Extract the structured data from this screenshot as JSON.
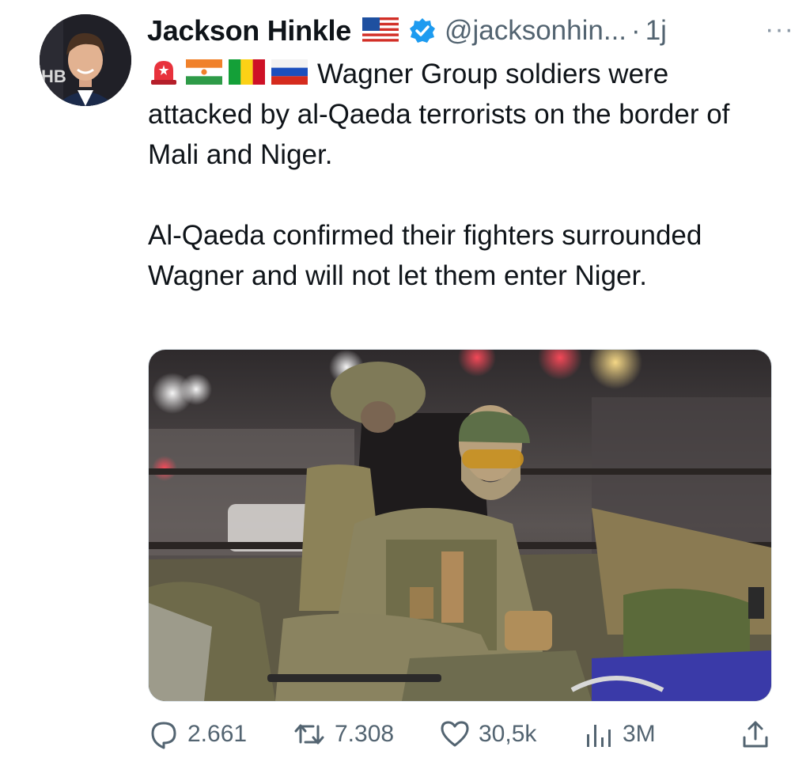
{
  "tweet": {
    "author_name": "Jackson Hinkle",
    "handle": "@jacksonhin...",
    "separator": "·",
    "time": "1j",
    "more": "···",
    "emoji_icons": [
      "rotating-light-icon",
      "niger-flag-icon",
      "mali-flag-icon",
      "russia-flag-icon"
    ],
    "text_line1": "Wagner Group soldiers were attacked by al-Qaeda terrorists on the border of Mali and Niger.",
    "text_line2": "Al-Qaeda confirmed their fighters surrounded Wagner and will not let them enter Niger.",
    "avatar_badge": "HB"
  },
  "stats": {
    "replies": "2.661",
    "reposts": "7.308",
    "likes": "30,5k",
    "views": "3M"
  },
  "colors": {
    "text": "#0f1419",
    "secondary": "#536471",
    "verified": "#1d9bf0"
  }
}
